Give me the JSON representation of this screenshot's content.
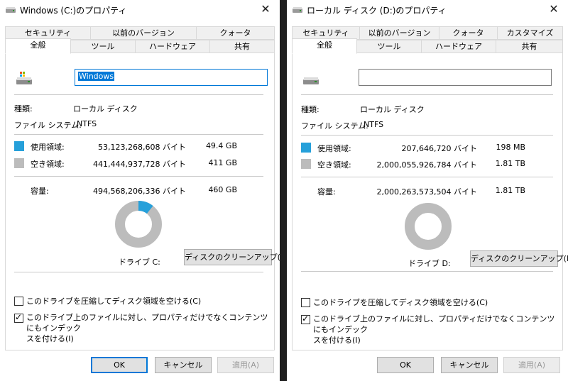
{
  "colors": {
    "used": "#26a0da",
    "free": "#bcbcbc",
    "accent": "#0078d7"
  },
  "icons": {
    "drive": "hard-drive-icon",
    "close": "close-icon",
    "check": "checkmark-icon"
  },
  "left": {
    "title": "Windows (C:)のプロパティ",
    "close_label": "✕",
    "tabs_row1": [
      "セキュリティ",
      "以前のバージョン",
      "クォータ"
    ],
    "tabs_row2": [
      "全般",
      "ツール",
      "ハードウェア",
      "共有"
    ],
    "active_tab": "全般",
    "name_value": "Windows",
    "type_label": "種類:",
    "type_value": "ローカル ディスク",
    "fs_label": "ファイル システム:",
    "fs_value": "NTFS",
    "used_label": "使用領域:",
    "used_bytes": "53,123,268,608 バイト",
    "used_size": "49.4 GB",
    "free_label": "空き領域:",
    "free_bytes": "441,444,937,728 バイト",
    "free_size": "411 GB",
    "cap_label": "容量:",
    "cap_bytes": "494,568,206,336 バイト",
    "cap_size": "460 GB",
    "used_fraction": 0.107,
    "drive_label": "ドライブ C:",
    "cleanup_label": "ディスクのクリーンアップ(D)",
    "compress_label": "このドライブを圧縮してディスク領域を空ける(C)",
    "compress_checked": false,
    "index_label_1": "このドライブ上のファイルに対し、プロパティだけでなくコンテンツにもインデック",
    "index_label_2": "スを付ける(I)",
    "index_checked": true,
    "ok_label": "OK",
    "cancel_label": "キャンセル",
    "apply_label": "適用(A)"
  },
  "right": {
    "title": "ローカル ディスク (D:)のプロパティ",
    "close_label": "✕",
    "tabs_row1": [
      "セキュリティ",
      "以前のバージョン",
      "クォータ",
      "カスタマイズ"
    ],
    "tabs_row2": [
      "全般",
      "ツール",
      "ハードウェア",
      "共有"
    ],
    "active_tab": "全般",
    "name_value": "",
    "type_label": "種類:",
    "type_value": "ローカル ディスク",
    "fs_label": "ファイル システム:",
    "fs_value": "NTFS",
    "used_label": "使用領域:",
    "used_bytes": "207,646,720 バイト",
    "used_size": "198 MB",
    "free_label": "空き領域:",
    "free_bytes": "2,000,055,926,784 バイト",
    "free_size": "1.81 TB",
    "cap_label": "容量:",
    "cap_bytes": "2,000,263,573,504 バイト",
    "cap_size": "1.81 TB",
    "used_fraction": 0.0001,
    "drive_label": "ドライブ D:",
    "cleanup_label": "ディスクのクリーンアップ(D)",
    "compress_label": "このドライブを圧縮してディスク領域を空ける(C)",
    "compress_checked": false,
    "index_label_1": "このドライブ上のファイルに対し、プロパティだけでなくコンテンツにもインデック",
    "index_label_2": "スを付ける(I)",
    "index_checked": true,
    "ok_label": "OK",
    "cancel_label": "キャンセル",
    "apply_label": "適用(A)"
  }
}
